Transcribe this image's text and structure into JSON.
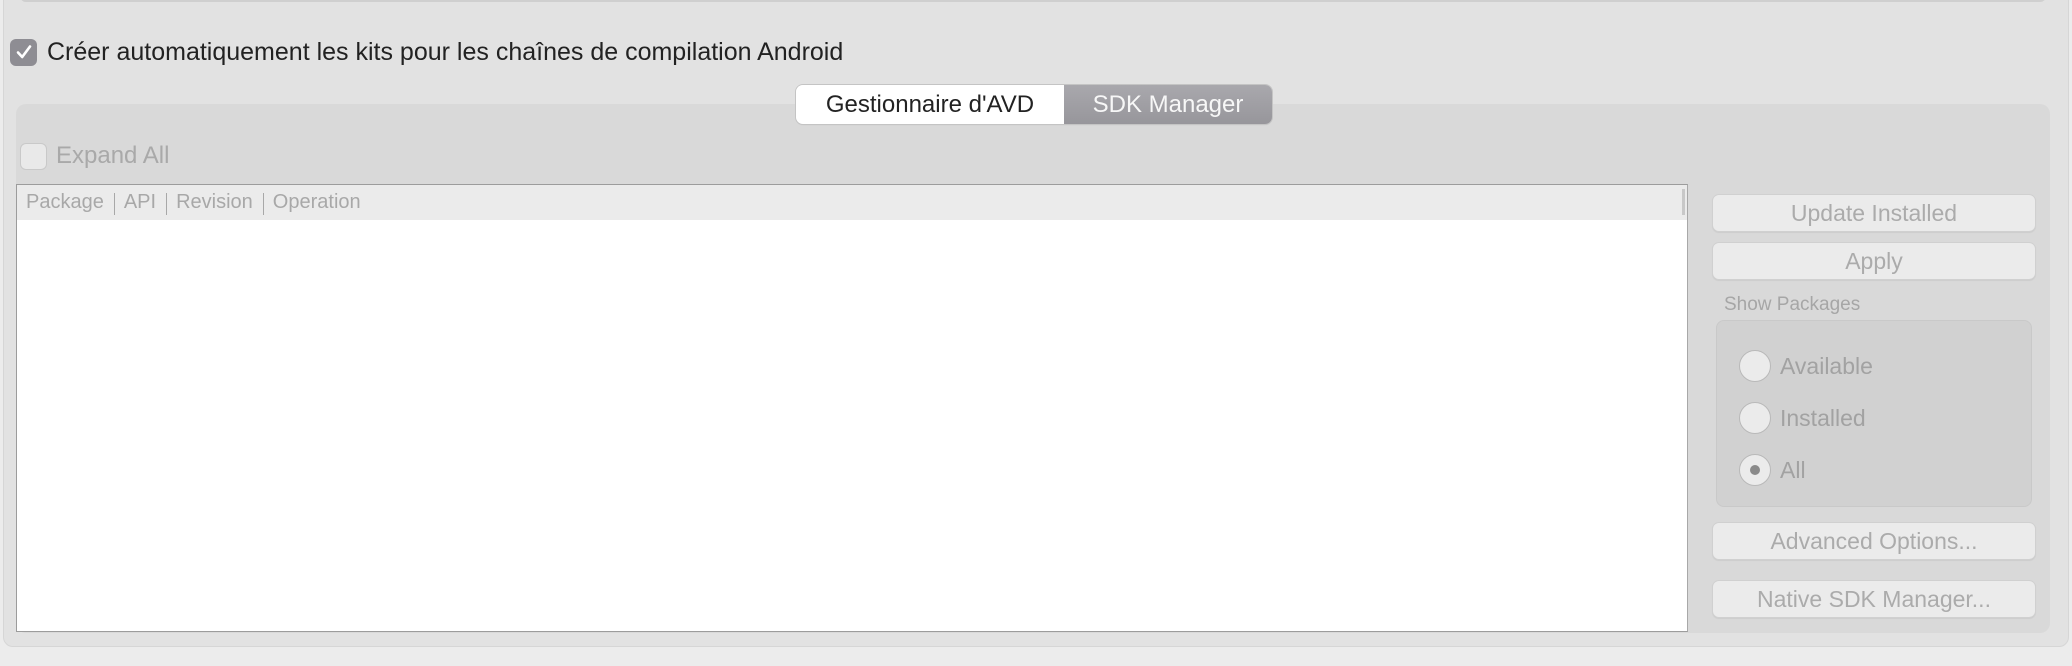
{
  "auto_kits": {
    "label": "Créer automatiquement les kits pour les chaînes de compilation Android",
    "checked": true
  },
  "tabs": [
    {
      "label": "Gestionnaire d'AVD",
      "selected": false
    },
    {
      "label": "SDK Manager",
      "selected": true
    }
  ],
  "sdk_manager": {
    "expand_all": {
      "label": "Expand All",
      "checked": false,
      "enabled": false
    },
    "table": {
      "columns": [
        "Package",
        "API",
        "Revision",
        "Operation"
      ],
      "rows": []
    },
    "buttons": {
      "update_installed": "Update Installed",
      "apply": "Apply",
      "advanced_options": "Advanced Options...",
      "native_sdk_manager": "Native SDK Manager..."
    },
    "show_packages": {
      "label": "Show Packages",
      "options": [
        {
          "label": "Available",
          "selected": false
        },
        {
          "label": "Installed",
          "selected": false
        },
        {
          "label": "All",
          "selected": true
        }
      ]
    }
  },
  "colors": {
    "selected_tab": "#9e9da2",
    "checkbox_checked": "#8e8d93",
    "disabled_text": "#a8a8a8"
  }
}
